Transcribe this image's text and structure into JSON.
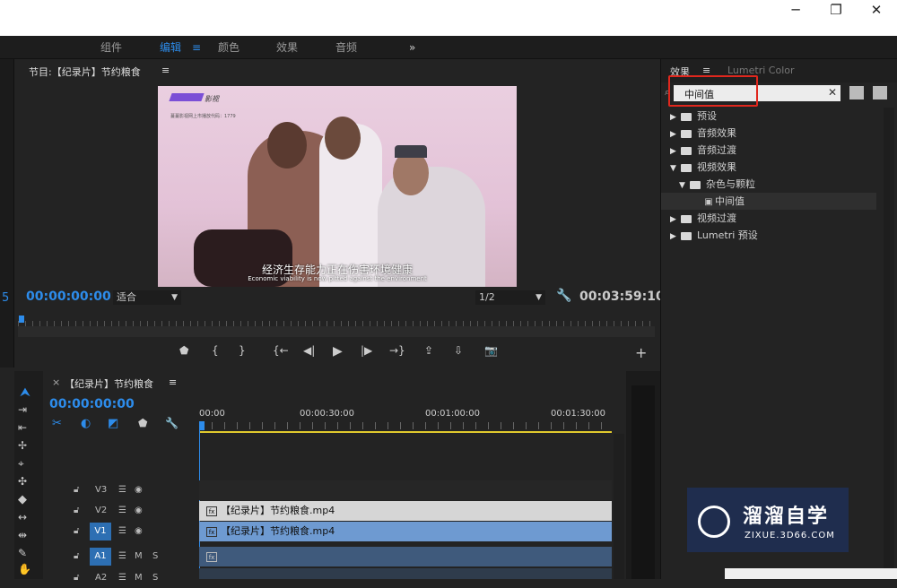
{
  "window": {
    "minimize": "─",
    "restore": "❐",
    "close": "✕"
  },
  "workspaces": [
    {
      "label": "组件"
    },
    {
      "label": "编辑",
      "menu": "≡"
    },
    {
      "label": "颜色"
    },
    {
      "label": "效果"
    },
    {
      "label": "音频"
    },
    {
      "label": "»"
    }
  ],
  "left_strip": {
    "value": "5"
  },
  "program": {
    "title": "节目:【纪录片】节约粮食",
    "menu": "≡",
    "video": {
      "logo_text": "影视",
      "logo_subtext": "蔓蔓影视网上市播放代码：1779",
      "subtitle_cn": "经济生存能力正在伤害环境健康",
      "subtitle_en": "Economic viability is now pitted against the environment"
    },
    "timecode": "00:00:00:00",
    "fit": "适合",
    "resolution": "1/2",
    "duration": "00:03:59:10"
  },
  "transport": {
    "marker": "⬟",
    "in": "{",
    "out": "}",
    "go_in": "{←",
    "step_back": "◀|",
    "play": "▶",
    "step_fwd": "|▶",
    "go_out": "→}",
    "lift": "⇪",
    "extract": "⇩",
    "export_frame": "📷",
    "add": "+"
  },
  "effects_panel": {
    "tab_effects": "效果",
    "tab_menu": "≡",
    "tab_lumetri": "Lumetri Color",
    "search_value": "中间值",
    "tree": [
      {
        "label": "预设",
        "expanded": false,
        "indent": 0,
        "star": true
      },
      {
        "label": "音频效果",
        "expanded": false,
        "indent": 0
      },
      {
        "label": "音频过渡",
        "expanded": false,
        "indent": 0
      },
      {
        "label": "视频效果",
        "expanded": true,
        "indent": 0
      },
      {
        "label": "杂色与颗粒",
        "expanded": true,
        "indent": 1
      },
      {
        "label": "中间值",
        "indent": 2,
        "effect": true
      },
      {
        "label": "视频过渡",
        "expanded": false,
        "indent": 0
      },
      {
        "label": "Lumetri 预设",
        "expanded": false,
        "indent": 0,
        "star": true
      }
    ]
  },
  "timeline": {
    "title": "【纪录片】节约粮食",
    "menu": "≡",
    "close": "×",
    "timecode": "00:00:00:00",
    "ruler": [
      "00:00",
      "00:00:30:00",
      "00:01:00:00",
      "00:01:30:00"
    ],
    "tracks": [
      {
        "name": "V3"
      },
      {
        "name": "V2",
        "clip": "【纪录片】节约粮食.mp4"
      },
      {
        "name": "V1",
        "clip": "【纪录片】节约粮食.mp4",
        "active": true
      },
      {
        "name": "A1",
        "m": "M",
        "s": "S",
        "active": true
      },
      {
        "name": "A2",
        "m": "M",
        "s": "S"
      }
    ]
  },
  "watermark": {
    "cn": "溜溜自学",
    "en": "ZIXUE.3D66.COM"
  },
  "colors": {
    "accent": "#2d8ceb",
    "highlight": "#e0271d",
    "v1clip": "#6e9ad1",
    "v2clip": "#d6d6d6"
  }
}
